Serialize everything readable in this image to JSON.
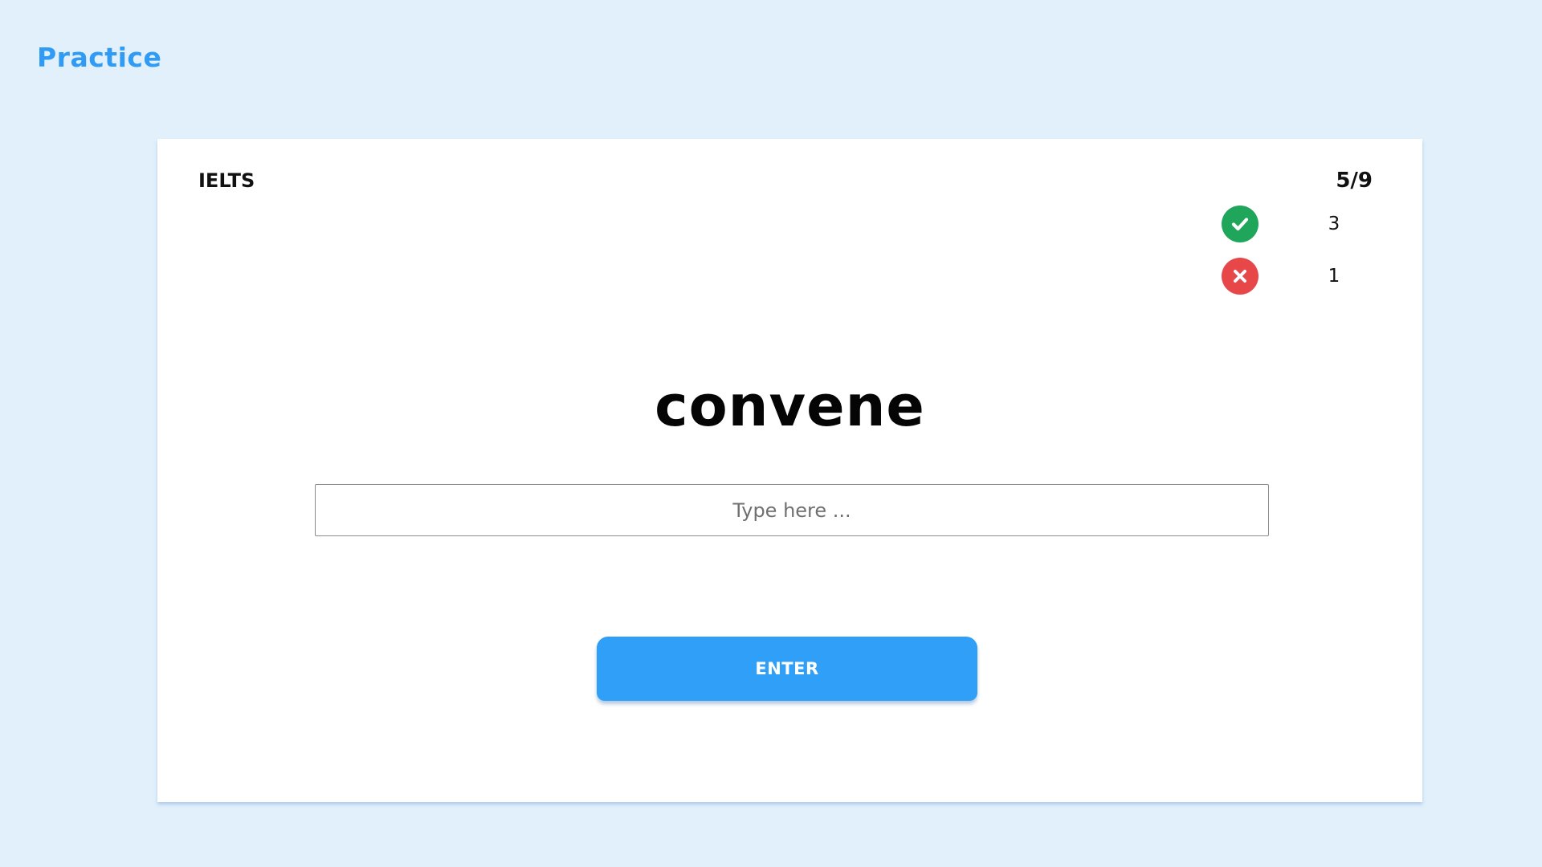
{
  "header": {
    "title": "Practice"
  },
  "card": {
    "deck": "IELTS",
    "progress": "5/9",
    "stats": {
      "correct": {
        "icon": "check-circle-icon",
        "count": "3",
        "color": "#1fa65b"
      },
      "wrong": {
        "icon": "x-circle-icon",
        "count": "1",
        "color": "#e8474a"
      }
    },
    "word": "convene",
    "input": {
      "value": "",
      "placeholder": "Type here ..."
    },
    "enter_label": "ENTER"
  },
  "colors": {
    "background": "#e1f0fb",
    "accent": "#2f9bf5",
    "button": "#2f9ff8"
  }
}
